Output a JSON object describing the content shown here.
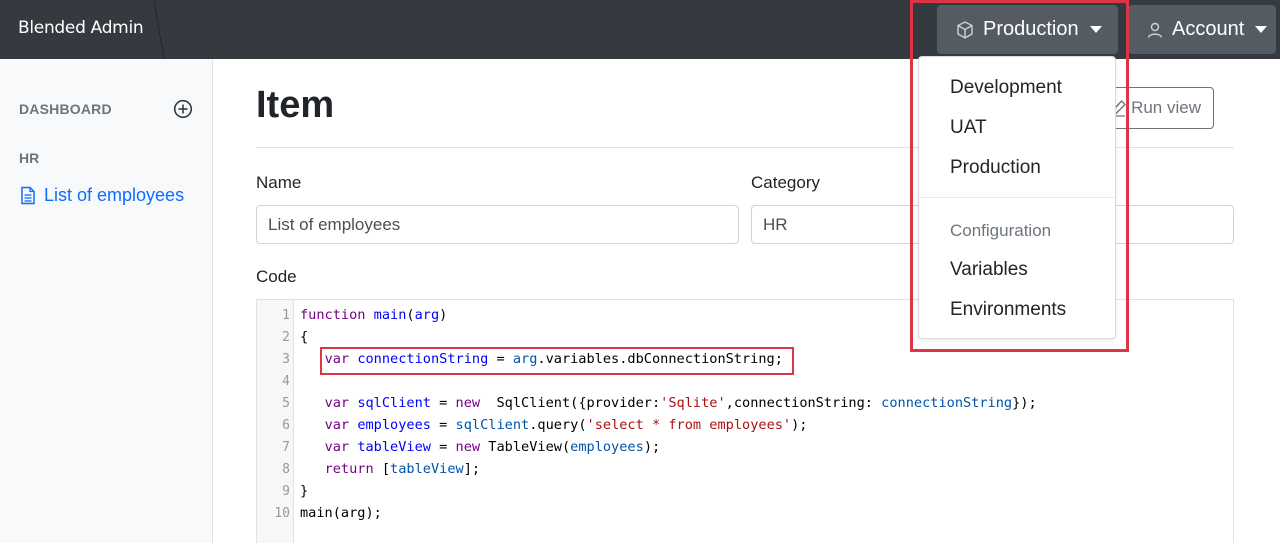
{
  "navbar": {
    "brand": "Blended Admin",
    "environment_button": "Production",
    "account_button": "Account"
  },
  "sidebar": {
    "dashboard_label": "DASHBOARD",
    "section_label": "HR",
    "items": [
      {
        "label": "List of employees",
        "active": true
      }
    ]
  },
  "main": {
    "title": "Item",
    "run_button": "Run view",
    "name_label": "Name",
    "name_value": "List of employees",
    "category_label": "Category",
    "category_value": "HR",
    "code_label": "Code",
    "code_lines": [
      [
        {
          "t": "function ",
          "c": "kw"
        },
        {
          "t": "main",
          "c": "def"
        },
        {
          "t": "(",
          "c": ""
        },
        {
          "t": "arg",
          "c": "def"
        },
        {
          "t": ")",
          "c": ""
        }
      ],
      [
        {
          "t": "{",
          "c": ""
        }
      ],
      [
        {
          "t": "   ",
          "c": ""
        },
        {
          "t": "var ",
          "c": "kw"
        },
        {
          "t": "connectionString",
          "c": "def"
        },
        {
          "t": " = ",
          "c": ""
        },
        {
          "t": "arg",
          "c": "var"
        },
        {
          "t": ".variables.dbConnectionString;",
          "c": ""
        }
      ],
      [
        {
          "t": "",
          "c": ""
        }
      ],
      [
        {
          "t": "   ",
          "c": ""
        },
        {
          "t": "var ",
          "c": "kw"
        },
        {
          "t": "sqlClient",
          "c": "def"
        },
        {
          "t": " = ",
          "c": ""
        },
        {
          "t": "new",
          "c": "kw"
        },
        {
          "t": "  SqlClient({provider:",
          "c": ""
        },
        {
          "t": "'Sqlite'",
          "c": "str"
        },
        {
          "t": ",connectionString: ",
          "c": ""
        },
        {
          "t": "connectionString",
          "c": "var"
        },
        {
          "t": "});",
          "c": ""
        }
      ],
      [
        {
          "t": "   ",
          "c": ""
        },
        {
          "t": "var ",
          "c": "kw"
        },
        {
          "t": "employees",
          "c": "def"
        },
        {
          "t": " = ",
          "c": ""
        },
        {
          "t": "sqlClient",
          "c": "var"
        },
        {
          "t": ".query(",
          "c": ""
        },
        {
          "t": "'select * from employees'",
          "c": "str"
        },
        {
          "t": ");",
          "c": ""
        }
      ],
      [
        {
          "t": "   ",
          "c": ""
        },
        {
          "t": "var ",
          "c": "kw"
        },
        {
          "t": "tableView",
          "c": "def"
        },
        {
          "t": " = ",
          "c": ""
        },
        {
          "t": "new",
          "c": "kw"
        },
        {
          "t": " TableView(",
          "c": ""
        },
        {
          "t": "employees",
          "c": "var"
        },
        {
          "t": ");",
          "c": ""
        }
      ],
      [
        {
          "t": "   ",
          "c": ""
        },
        {
          "t": "return",
          "c": "kw"
        },
        {
          "t": " [",
          "c": ""
        },
        {
          "t": "tableView",
          "c": "var"
        },
        {
          "t": "];",
          "c": ""
        }
      ],
      [
        {
          "t": "}",
          "c": ""
        }
      ],
      [
        {
          "t": "main(arg);",
          "c": ""
        }
      ]
    ]
  },
  "environment_menu": {
    "items": [
      "Development",
      "UAT",
      "Production"
    ],
    "config_header": "Configuration",
    "config_items": [
      "Variables",
      "Environments"
    ]
  },
  "colors": {
    "navbar": "#343a40",
    "nav_button": "#545b62",
    "link": "#0d6efd",
    "highlight_outline": "#dc3545"
  }
}
